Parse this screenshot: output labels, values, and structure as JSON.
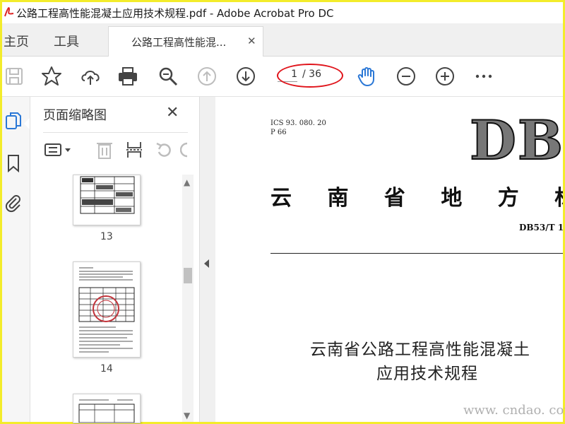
{
  "window": {
    "title": "公路工程高性能混凝土应用技术规程.pdf - Adobe Acrobat Pro DC"
  },
  "tabs": {
    "home": "主页",
    "tools": "工具",
    "document": "公路工程高性能混...",
    "close_glyph": "✕"
  },
  "toolbar": {
    "page_current": "1",
    "page_total": "/ 36",
    "icons": [
      "save-icon",
      "bookmark-star-icon",
      "upload-cloud-icon",
      "print-icon",
      "zoom-search-icon",
      "page-up-icon",
      "page-down-icon",
      "hand-tool-icon",
      "zoom-out-icon",
      "zoom-in-icon",
      "more-icon"
    ],
    "accent": "#2b78d6",
    "highlight_color": "#e0141b"
  },
  "panel": {
    "title": "页面缩略图",
    "close_glyph": "✕",
    "thumbnails": [
      {
        "label": "13"
      },
      {
        "label": "14"
      }
    ]
  },
  "document": {
    "ics": "ICS  93. 080. 20",
    "p": "P  66",
    "db_logo": "DB",
    "standard_title": "云 南 省 地 方 标",
    "standard_number": "DB53/T  1",
    "title_line1": "云南省公路工程高性能混凝土",
    "title_line2": "应用技术规程"
  },
  "watermark": "www. cndao. com"
}
